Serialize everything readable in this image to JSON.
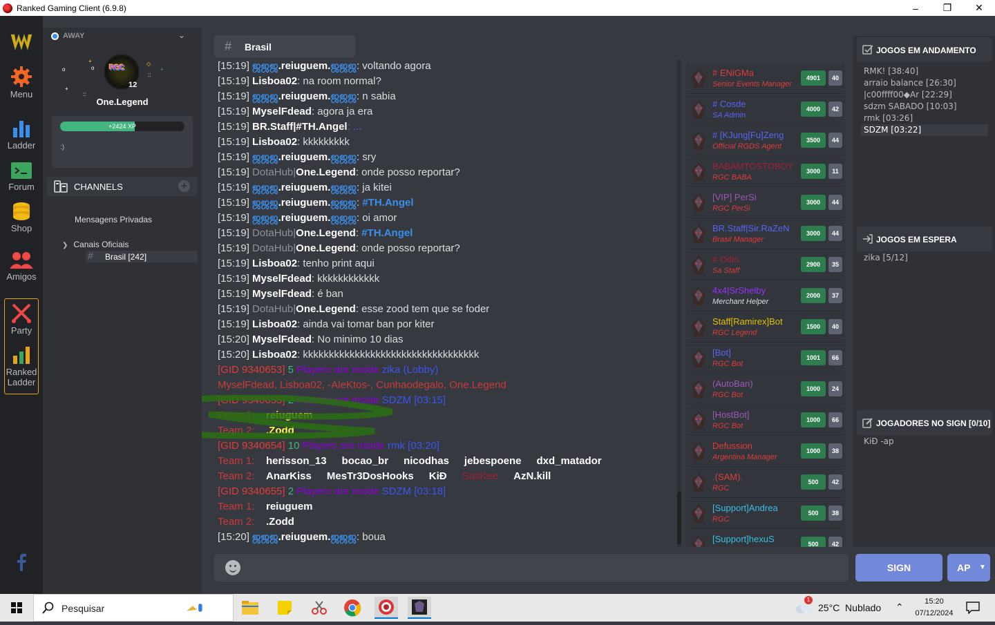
{
  "window": {
    "title": "Ranked Gaming Client (6.9.8)"
  },
  "nav": [
    {
      "label": "Menu"
    },
    {
      "label": "Ladder"
    },
    {
      "label": "Forum"
    },
    {
      "label": "Shop"
    },
    {
      "label": "Amigos"
    },
    {
      "label": "Party"
    },
    {
      "label": "Ranked Ladder"
    }
  ],
  "profile": {
    "status": "AWAY",
    "username": "One.Legend",
    "level": "12",
    "xp_label": "+2424 XP",
    "xp_progress": 0.6,
    "status_message": ":)"
  },
  "channels": {
    "header": "CHANNELS",
    "private": "Mensagens Privadas",
    "category": "Canais Oficiais",
    "active": "Brasil [242]"
  },
  "chat": {
    "channel_name": "Brasil",
    "messages": [
      {
        "ts": "[15:19]",
        "pre": "ஜஜஜ",
        "name": ".reiuguem.",
        "post": "ஜஜஜ",
        "text": ": voltando agora"
      },
      {
        "ts": "[15:19]",
        "name": "Lisboa02",
        "text": ": na room normal?"
      },
      {
        "ts": "[15:19]",
        "pre": "ஜஜஜ",
        "name": ".reiuguem.",
        "post": "ஜஜஜ",
        "text": ": n sabia"
      },
      {
        "ts": "[15:19]",
        "name": "MyselFdead",
        "text": ": agora ja era"
      },
      {
        "staff": true,
        "ts": "[15:19]",
        "name": "BR.Staff|#TH.Angel",
        "text": ": ..."
      },
      {
        "ts": "[15:19]",
        "name": "Lisboa02",
        "text": ": kkkkkkkkk"
      },
      {
        "ts": "[15:19]",
        "pre": "ஜஜஜ",
        "name": ".reiuguem.",
        "post": "ஜஜஜ",
        "text": ": sry"
      },
      {
        "ts": "[15:19]",
        "tag": "DotaHub",
        "name": "One.Legend",
        "text": ": onde posso reportar?"
      },
      {
        "ts": "[15:19]",
        "pre": "ஜஜஜ",
        "name": ".reiuguem.",
        "post": "ஜஜஜ",
        "text": ": ja kitei"
      },
      {
        "ts": "[15:19]",
        "pre": "ஜஜஜ",
        "name": ".reiuguem.",
        "post": "ஜஜஜ",
        "text": ": ",
        "ref": "#TH.Angel"
      },
      {
        "ts": "[15:19]",
        "pre": "ஜஜஜ",
        "name": ".reiuguem.",
        "post": "ஜஜஜ",
        "text": ": oi amor"
      },
      {
        "ts": "[15:19]",
        "tag": "DotaHub",
        "name": "One.Legend",
        "text": ": ",
        "ref": "#TH.Angel"
      },
      {
        "ts": "[15:19]",
        "tag": "DotaHub",
        "name": "One.Legend",
        "text": ": onde posso reportar?"
      },
      {
        "ts": "[15:19]",
        "name": "Lisboa02",
        "text": ": tenho print aqui"
      },
      {
        "ts": "[15:19]",
        "name": "MyselFdead",
        "text": ": kkkkkkkkkkkk"
      },
      {
        "ts": "[15:19]",
        "name": "MyselFdead",
        "text": ": é ban"
      },
      {
        "ts": "[15:19]",
        "tag": "DotaHub",
        "name": "One.Legend",
        "text": ": esse zood tem que se foder"
      },
      {
        "ts": "[15:19]",
        "name": "Lisboa02",
        "text": ": ainda vai tomar ban por kiter"
      },
      {
        "ts": "[15:20]",
        "name": "MyselFdead",
        "text": ": No minimo 10 dias"
      },
      {
        "ts": "[15:20]",
        "name": "Lisboa02",
        "text": ": kkkkkkkkkkkkkkkkkkkkkkkkkkkkkkkkkk"
      }
    ],
    "games": [
      {
        "gid": "[GID 9340653]",
        "count": "5",
        "players_text": "Players are inside",
        "game": "zika (Lobby)",
        "list": "MyselFdead, Lisboa02, -AleKtos-, Cunhaodegalo, One.Legend"
      },
      {
        "gid": "[GID 9340655]",
        "count": "2",
        "players_text": "Players are inside",
        "game": "SDZM [03:15]",
        "team1_label": "Team 1:",
        "team1": [
          "reiuguem"
        ],
        "team2_label": "Team 2:",
        "team2": [
          ".Zodd"
        ]
      },
      {
        "gid": "[GID 9340654]",
        "count": "10",
        "players_text": "Players are inside",
        "game": "rmk [03:20]",
        "team1_label": "Team 1:",
        "team1": [
          "herisson_13",
          "bocao_br",
          "nicodhas",
          "jebespoene",
          "dxd_matador"
        ],
        "team2_label": "Team 2:",
        "team2": [
          "AnarKiss",
          "MesTr3DosHooks",
          "KiĐ",
          "SasKee",
          "AzN.kill"
        ]
      },
      {
        "gid": "[GID 9340655]",
        "count": "2",
        "players_text": "Players are inside",
        "game": "SDZM [03:18]",
        "team1_label": "Team 1:",
        "team1": [
          "reiuguem"
        ],
        "team2_label": "Team 2:",
        "team2": [
          ".Zodd"
        ]
      }
    ],
    "last": {
      "ts": "[15:20]",
      "pre": "ஜஜஜ",
      "name": ".reiuguem.",
      "post": "ஜஜஜ",
      "text": ": boua"
    }
  },
  "members": [
    {
      "name": "# ENiGMa",
      "role": "Senior Events Manager",
      "points": "4901",
      "level": "40",
      "name_color": "#e03c3c",
      "role_color": "#e03c3c"
    },
    {
      "name": "# Cosde",
      "role": "SA Admin",
      "points": "4000",
      "level": "42",
      "name_color": "#5865f2",
      "role_color": "#5865f2"
    },
    {
      "name": "# [KJung[Fu]Zeng",
      "role": "Official RGDS Agent",
      "points": "3500",
      "level": "44",
      "name_color": "#5865f2",
      "role_color": "#e03c3c"
    },
    {
      "name": "BABAMTOSTOBOY",
      "role": "RGC BABA",
      "points": "3000",
      "level": "11",
      "name_color": "#a0213a",
      "role_color": "#e03c3c"
    },
    {
      "name": "[VIP] PerSi",
      "role": "RGC PerSi",
      "points": "3000",
      "level": "44",
      "name_color": "#9b59b6",
      "role_color": "#e03c3c"
    },
    {
      "name": "BR.Staff|Sir.RaZeN",
      "role": "Brasil Manager",
      "points": "3000",
      "level": "44",
      "name_color": "#5865f2",
      "role_color": "#e03c3c"
    },
    {
      "name": "# Odin",
      "role": "Sa Staff",
      "points": "2900",
      "level": "35",
      "name_color": "#a0213a",
      "role_color": "#e03c3c"
    },
    {
      "name": "4x4|SrShelby",
      "role": "Merchant Helper",
      "points": "2000",
      "level": "37",
      "name_color": "#9b30ff",
      "role_color": "#dcddde"
    },
    {
      "name": "Staff[Ramirex]Bot",
      "role": "RGC Legend",
      "points": "1500",
      "level": "40",
      "name_color": "#e0c000",
      "role_color": "#e03c3c"
    },
    {
      "name": "[Bot]",
      "role": "RGC Bot",
      "points": "1001",
      "level": "66",
      "name_color": "#5865f2",
      "role_color": "#e03c3c"
    },
    {
      "name": "(AutoBan)",
      "role": "RGC Bot",
      "points": "1000",
      "level": "24",
      "name_color": "#9b59b6",
      "role_color": "#e03c3c"
    },
    {
      "name": "[HostBot]",
      "role": "RGC Bot",
      "points": "1000",
      "level": "66",
      "name_color": "#9b59b6",
      "role_color": "#e03c3c"
    },
    {
      "name": "Defussion",
      "role": "Argentina Manager",
      "points": "1000",
      "level": "38",
      "name_color": "#e03c3c",
      "role_color": "#e03c3c"
    },
    {
      "name": ".(SAM).",
      "role": "RGC",
      "points": "500",
      "level": "42",
      "name_color": "#e03c3c",
      "role_color": "#e03c3c"
    },
    {
      "name": "[Support]Andrea",
      "role": "RGC",
      "points": "500",
      "level": "38",
      "name_color": "#3bbfe6",
      "role_color": "#e03c3c"
    },
    {
      "name": "[Support]hexuS",
      "role": "",
      "points": "500",
      "level": "42",
      "name_color": "#3bbfe6",
      "role_color": "#e03c3c"
    }
  ],
  "games_panel": {
    "in_progress_title": "JOGOS EM ANDAMENTO",
    "in_progress": [
      "RMK! [38:40]",
      "arraio balance [26:30]",
      "|c00ffff00◆Ar [22:29]",
      "sdzm SABADO [10:03]",
      "rmk [03:26]",
      "SDZM [03:22]"
    ],
    "waiting_title": "JOGOS EM ESPERA",
    "waiting": [
      "zika [5/12]"
    ],
    "sign_title": "JOGADORES NO SIGN [0/10]",
    "sign": [
      "KiĐ -ap"
    ]
  },
  "buttons": {
    "sign": "SIGN",
    "ap": "AP"
  },
  "taskbar": {
    "search_placeholder": "Pesquisar",
    "weather": "25°C  Nublado",
    "weather_badge": "1",
    "time": "15:20",
    "date": "07/12/2024"
  }
}
